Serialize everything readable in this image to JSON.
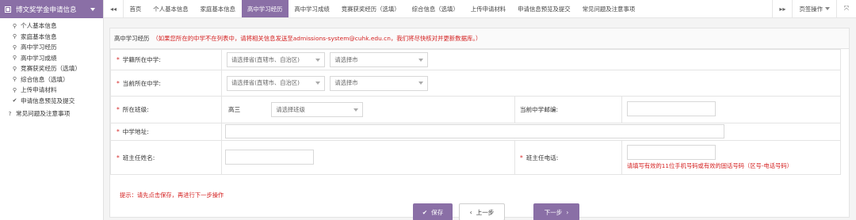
{
  "sidebar": {
    "header": "博文奖学金申请信息",
    "items": [
      {
        "label": "个人基本信息",
        "icon": "pin-icon"
      },
      {
        "label": "家庭基本信息",
        "icon": "pin-icon"
      },
      {
        "label": "高中学习经历",
        "icon": "pin-icon"
      },
      {
        "label": "高中学习成绩",
        "icon": "pin-icon"
      },
      {
        "label": "竞赛获奖经历（选填）",
        "icon": "pin-icon"
      },
      {
        "label": "综合信息（选填）",
        "icon": "pin-icon"
      },
      {
        "label": "上传申请材料",
        "icon": "pin-icon"
      },
      {
        "label": "申请信息预览及提交",
        "icon": "check-icon"
      }
    ],
    "faq": "常见问题及注意事项"
  },
  "topbar": {
    "tabs": [
      "首页",
      "个人基本信息",
      "家庭基本信息",
      "高中学习经历",
      "高中学习成绩",
      "竞赛获奖经历（选填）",
      "综合信息（选填）",
      "上传申请材料",
      "申请信息预览及提交",
      "常见问题及注意事项"
    ],
    "active_index": 3,
    "page_ops": "页签操作"
  },
  "panel": {
    "title": "高中学习经历",
    "title_note": "（如果您所在的中学不在列表中，请将相关信息发送至admissions-system@cuhk.edu.cn，我们将尽快核对并更新数据库。）"
  },
  "form": {
    "register_school_label": "学籍所在中学:",
    "current_school_label": "当前所在中学:",
    "province_placeholder": "请选择省(直辖市、自治区)",
    "city_placeholder": "请选择市",
    "class_label": "所在班级:",
    "grade_value": "高三",
    "class_placeholder": "请选择班级",
    "zip_label": "当前中学邮编:",
    "address_label": "中学地址:",
    "teacher_name_label": "班主任姓名:",
    "teacher_phone_label": "班主任电话:",
    "phone_hint": "请填写有效的11位手机号码或有效的固话号码（区号-电话号码）"
  },
  "tip": "提示：请先点击保存，再进行下一步操作",
  "buttons": {
    "save": "保存",
    "prev": "上一步",
    "next": "下一步"
  },
  "colors": {
    "accent": "#8a6fa6",
    "error": "#d42020"
  }
}
